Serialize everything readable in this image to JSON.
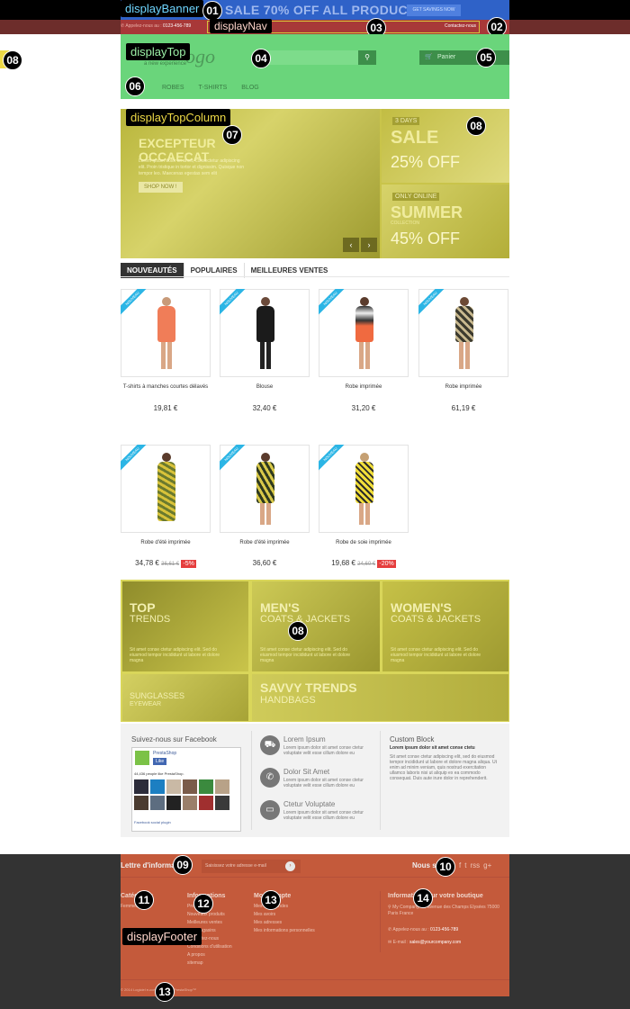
{
  "banner": {
    "text": "SALE 70% OFF ALL PRODUCTS",
    "button": "GET SAVINGS NOW"
  },
  "nav": {
    "phone_label": "Appelez-nous au :",
    "phone": "0123-456-789",
    "contact": "Contactez-nous"
  },
  "header": {
    "logo": "ogo",
    "logo_sub": "a new experience",
    "cart": "Panier",
    "search_icon": "search-icon",
    "menu": [
      "ROBES",
      "T-SHIRTS",
      "BLOG"
    ]
  },
  "hooks": {
    "displayBanner": "displayBanner",
    "displayNav": "displayNav",
    "displayTop": "displayTop",
    "displayTopColumn": "displayTopColumn",
    "displayFooter": "displayFooter"
  },
  "markers": [
    "01",
    "02",
    "03",
    "04",
    "05",
    "06",
    "07",
    "08",
    "09",
    "10",
    "11",
    "12",
    "13",
    "14"
  ],
  "slider": {
    "title": "EXCEPTEUR OCCAECAT",
    "desc": "Lorem ipsum dolor sit amet, consectetur adipiscing elit. Proin tristique in tortor et dignissim. Quisque non tempor leo. Maecenas egestas sem elit",
    "button": "SHOP NOW !",
    "r1_tag": "3 DAYS",
    "r1_big": "SALE",
    "r1_pct": "25% OFF",
    "r2_tag": "ONLY ONLINE",
    "r2_big": "SUMMER",
    "r2_sub": "COLLECTION",
    "r2_pct": "45% OFF"
  },
  "tabs": [
    "NOUVEAUTÉS",
    "POPULAIRES",
    "MEILLEURES VENTES"
  ],
  "ribbon": "NOUVEAU",
  "products": [
    {
      "name": "T-shirts à manches courtes délavés",
      "price": "19,81 €",
      "old": "",
      "disc": ""
    },
    {
      "name": "Blouse",
      "price": "32,40 €",
      "old": "",
      "disc": ""
    },
    {
      "name": "Robe imprimée",
      "price": "31,20 €",
      "old": "",
      "disc": ""
    },
    {
      "name": "Robe imprimée",
      "price": "61,19 €",
      "old": "",
      "disc": ""
    },
    {
      "name": "Robe d'été imprimée",
      "price": "34,78 €",
      "old": "36,61 €",
      "disc": "-5%"
    },
    {
      "name": "Robe d'été imprimée",
      "price": "36,60 €",
      "old": "",
      "disc": ""
    },
    {
      "name": "Robe de soie imprimée",
      "price": "19,68 €",
      "old": "24,60 €",
      "disc": "-20%"
    }
  ],
  "banners": {
    "b1": {
      "t": "TOP",
      "s": "TRENDS",
      "d": "Sit amet conse ctetur adipiscing elit. Sed do eiusmod tempor incididunt ut labore et dolore magna"
    },
    "b2": {
      "t": "MEN'S",
      "s": "COATS & JACKETS",
      "d": "Sit amet conse ctetur adipiscing elit. Sed do eiusmod tempor incididunt ut labore et dolore magna"
    },
    "b3": {
      "t": "WOMEN'S",
      "s": "COATS & JACKETS",
      "d": "Sit amet conse ctetur adipiscing elit. Sed do eiusmod tempor incididunt ut labore et dolore magna"
    },
    "b4": {
      "t": "SUNGLASSES",
      "s": "EYEWEAR"
    },
    "b5": {
      "t": "SAVVY TRENDS",
      "s": "HANDBAGS"
    }
  },
  "facebook": {
    "title": "Suivez-nous sur Facebook",
    "page": "PrestaShop",
    "like": "Like",
    "people": "44,436 people like PrestaShop.",
    "plugin": "Facebook social plugin"
  },
  "cms": [
    {
      "icon": "truck-icon",
      "glyph": "⛟",
      "h": "Lorem Ipsum",
      "p": "Lorem ipsum dolor sit amet conse ctetur voluptate velit esse cillum dolore eu"
    },
    {
      "icon": "phone-icon",
      "glyph": "✆",
      "h": "Dolor Sit Amet",
      "p": "Lorem ipsum dolor sit amet conse ctetur voluptate velit esse cillum dolore eu"
    },
    {
      "icon": "credit-card-icon",
      "glyph": "▭",
      "h": "Ctetur Voluptate",
      "p": "Lorem ipsum dolor sit amet conse ctetur voluptate velit esse cillum dolore eu"
    }
  ],
  "custom": {
    "h": "Custom Block",
    "b": "Lorem ipsum dolor sit amet conse ctetu",
    "p": "Sit amet conse ctetur adipiscing elit, sed do eiusmod tempor incididunt ut labore et dolore magna aliqua. Ut enim ad minim veniam, quis nostrud exercitation ullamco laboris nisi ut aliquip ex ea commodo consequat. Duis aute irure dolor in reprehenderit."
  },
  "footer": {
    "newsletter": "Lettre d'information",
    "newsletter_placeholder": "Saisissez votre adresse e-mail",
    "follow": "Nous suivre",
    "social": [
      "f",
      "t",
      "rss",
      "g+"
    ],
    "col1": {
      "h": "Catégories",
      "l": [
        "Femmes"
      ]
    },
    "col2": {
      "h": "Informations",
      "l": [
        "Promotions",
        "Nouveaux produits",
        "Meilleures ventes",
        "Nos magasins",
        "Contactez-nous",
        "Conditions d'utilisation",
        "A propos",
        "sitemap"
      ]
    },
    "col3": {
      "h": "Mon compte",
      "l": [
        "Mes commandes",
        "Mes avoirs",
        "Mes adresses",
        "Mes informations personnelles"
      ]
    },
    "col4": {
      "h": "Informations sur votre boutique",
      "addr": "My Company, 42 avenue des Champs Elysées 75000 Paris France",
      "call": "Appelez-nous au :",
      "phone": "0123-456-789",
      "email_label": "E-mail :",
      "email": "sales@yourcompany.com"
    },
    "copy": "© 2014 Logiciel e-commerce par PrestaShop™"
  }
}
